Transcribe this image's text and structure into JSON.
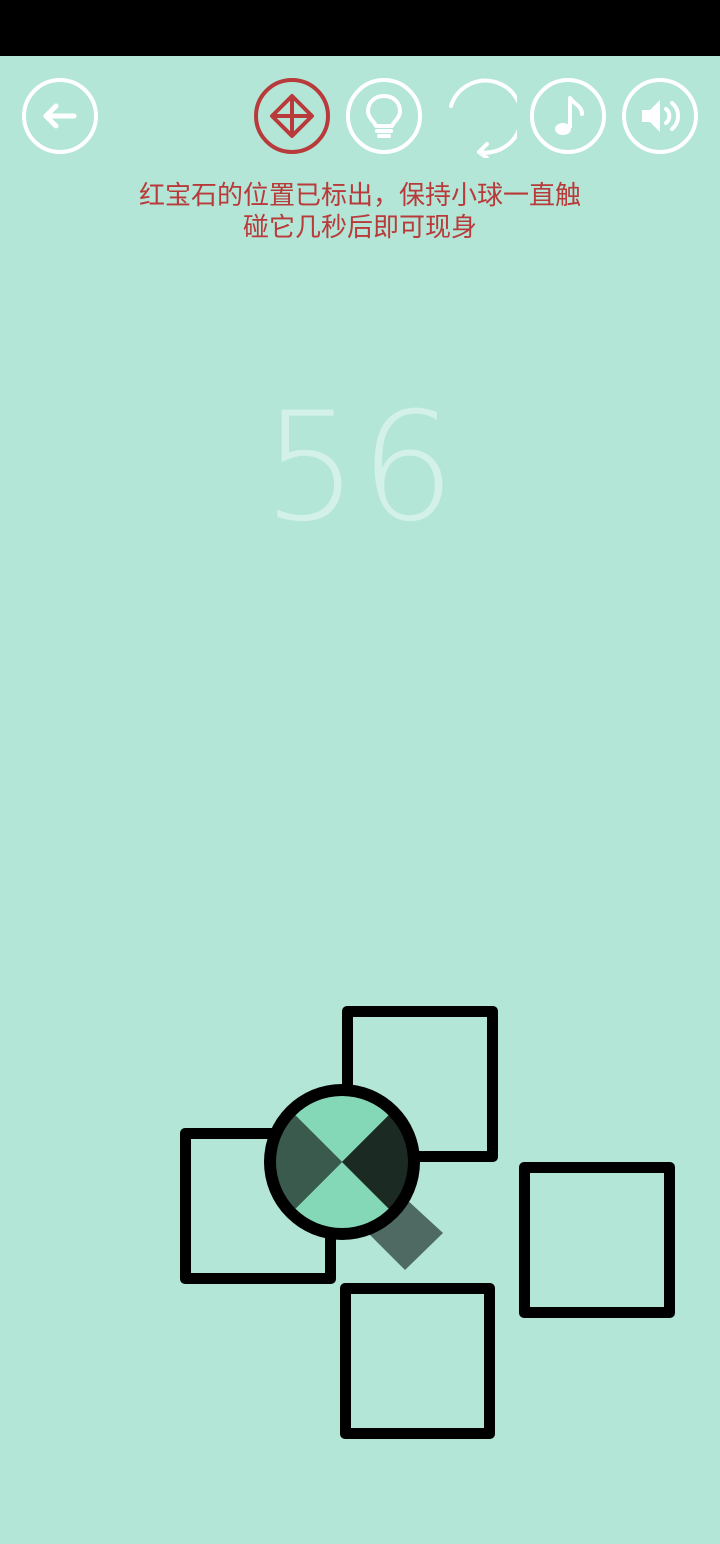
{
  "toolbar": {
    "back_icon": "back-arrow-icon",
    "gem_icon": "ruby-marker-icon",
    "hint_icon": "lightbulb-icon",
    "restart_icon": "restart-icon",
    "music_icon": "music-note-icon",
    "sound_icon": "speaker-icon"
  },
  "hint": {
    "line1": "红宝石的位置已标出，保持小球一直触",
    "line2": "碰它几秒后即可现身"
  },
  "score": "56",
  "colors": {
    "background": "#b3e6d6",
    "accent_red": "#b83a3a",
    "ball_light": "#84d8b8",
    "ball_dark_left": "#3a5a4e",
    "ball_dark_right": "#1c2a24",
    "tail": "#4e6a62"
  }
}
